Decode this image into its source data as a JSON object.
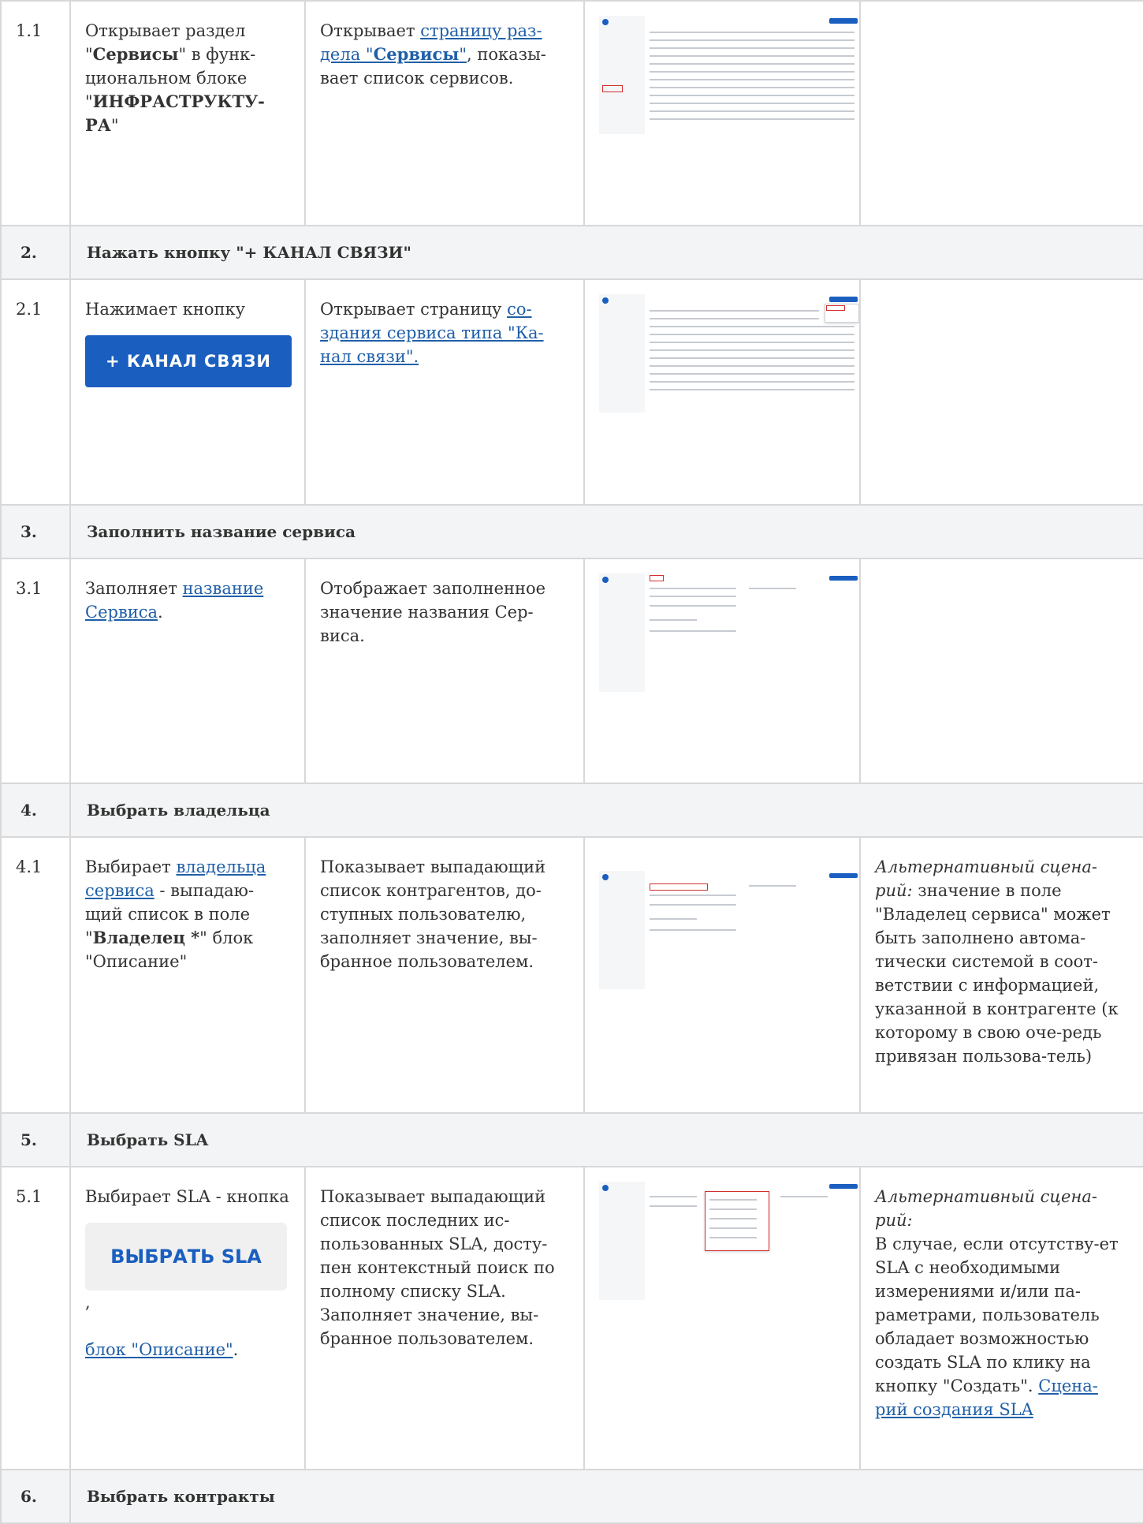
{
  "rows": [
    {
      "type": "step",
      "num": "1.1",
      "actor_html": "Открывает раздел \"<b>Сервисы</b>\" в функ-циональном блоке \"<b>ИНФРАСТРУКТУ-РА</b>\"",
      "system_html": "Открывает <a>страницу раз-дела \"<b>Сервисы</b>\"</a>, показы-вает список сервисов.",
      "note_html": ""
    },
    {
      "type": "head",
      "num": "2.",
      "title": "Нажать кнопку \"+ КАНАЛ СВЯЗИ\""
    },
    {
      "type": "step",
      "num": "2.1",
      "actor_html": "Нажимает кнопку",
      "button": "+ КАНАЛ СВЯЗИ",
      "system_html": "Открывает страницу <a>со-здания сервиса типа \"Ка-нал связи\".</a>",
      "note_html": ""
    },
    {
      "type": "head",
      "num": "3.",
      "title": "Заполнить название сервиса"
    },
    {
      "type": "step",
      "num": "3.1",
      "actor_html": "Заполняет <a>название Сервиса</a>.",
      "system_html": "Отображает заполненное значение названия Сер-виса.",
      "note_html": ""
    },
    {
      "type": "head",
      "num": "4.",
      "title": "Выбрать владельца"
    },
    {
      "type": "step",
      "num": "4.1",
      "actor_html": "Выбирает <a>владельца сервиса</a> - выпадаю-щий список в поле \"<b>Владелец *</b>\" блок \"Описание\"",
      "system_html": "Показывает выпадающий список контрагентов, до-ступных пользователю, заполняет значение, вы-бранное пользователем.",
      "note_html": "<i>Альтернативный сцена-рий:</i> значение в поле \"Владелец сервиса\" может быть заполнено автома-тически системой в соот-ветствии с информацией, указанной в контрагенте (к которому в свою оче-редь привязан пользова-тель)"
    },
    {
      "type": "head",
      "num": "5.",
      "title": "Выбрать SLA"
    },
    {
      "type": "step",
      "num": "5.1",
      "actor_html": "Выбирает SLA - кнопка",
      "button_sla": "ВЫБРАТЬ SLA",
      "actor_after_html": "<a>блок \"Описание\"</a>.",
      "system_html": "Показывает выпадающий список последних ис-пользованных SLA, досту-пен контекстный поиск по полному списку SLA. Заполняет значение, вы-бранное пользователем.",
      "note_html": "<i>Альтернативный сцена-рий:</i><br>В случае, если отсутству-ет SLA с необходимыми измерениями и/или па-раметрами, пользователь обладает возможностью создать SLA по клику на кнопку \"Создать\". <a>Сцена-рий создания SLA</a>"
    },
    {
      "type": "head",
      "num": "6.",
      "title": "Выбрать контракты"
    }
  ]
}
